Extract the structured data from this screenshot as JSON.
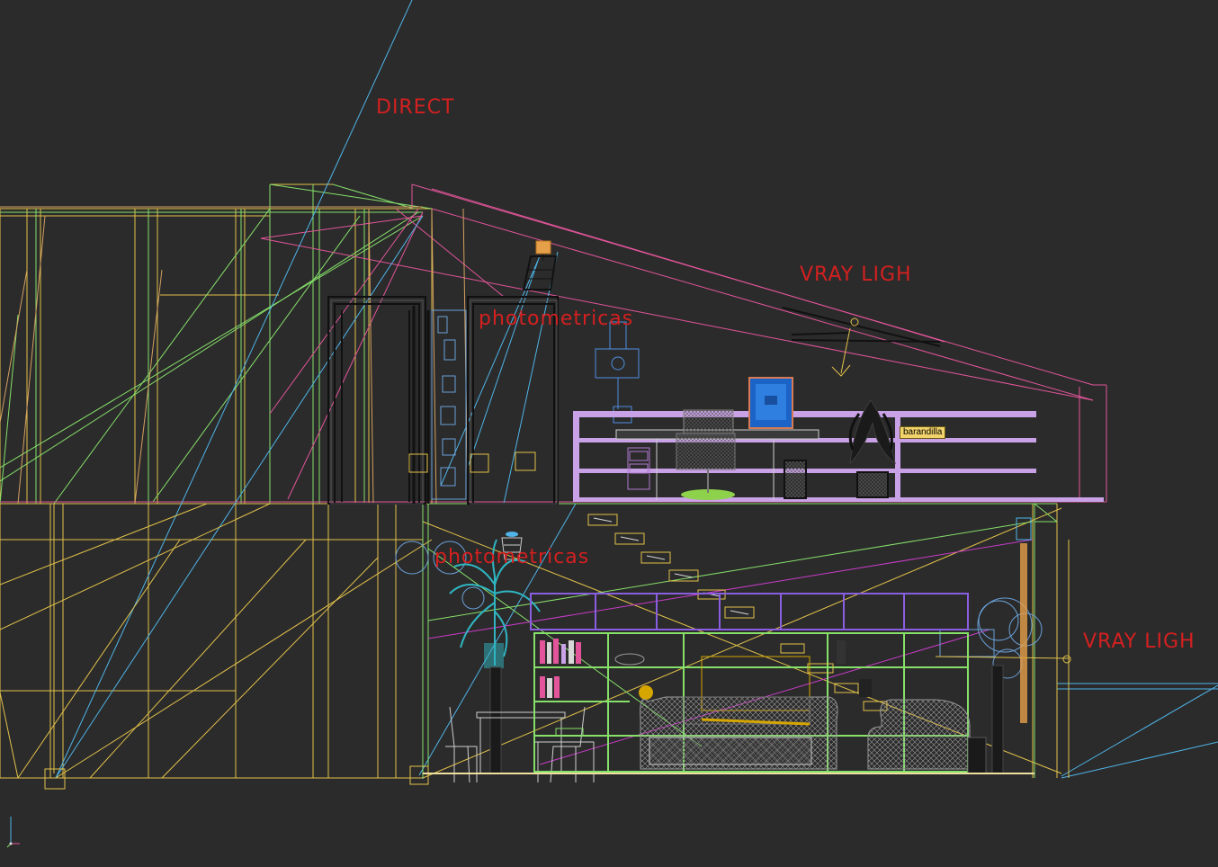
{
  "viewport": {
    "background": "#2b2b2b",
    "labels": {
      "direct": "DIRECT",
      "vray_light_upper": "VRAY LIGH",
      "vray_light_lower": "VRAY LIGH",
      "photometric_upper": "photometricas",
      "photometric_lower": "photometricas"
    },
    "object_tag": "barandilla",
    "label_color": "#d42020",
    "wire_colors": {
      "yellow": "#e3c24a",
      "green": "#86e06a",
      "pink": "#e2559a",
      "cyan": "#4fb4e8",
      "lavender": "#c9a1e6",
      "orange": "#e7a04a",
      "teal": "#2fb6c2",
      "white": "#d8d8d8",
      "magenta": "#c83cc8",
      "gray": "#8a8a8a"
    }
  },
  "axis_gizmo": {
    "icon": "axis-tripod-icon"
  }
}
